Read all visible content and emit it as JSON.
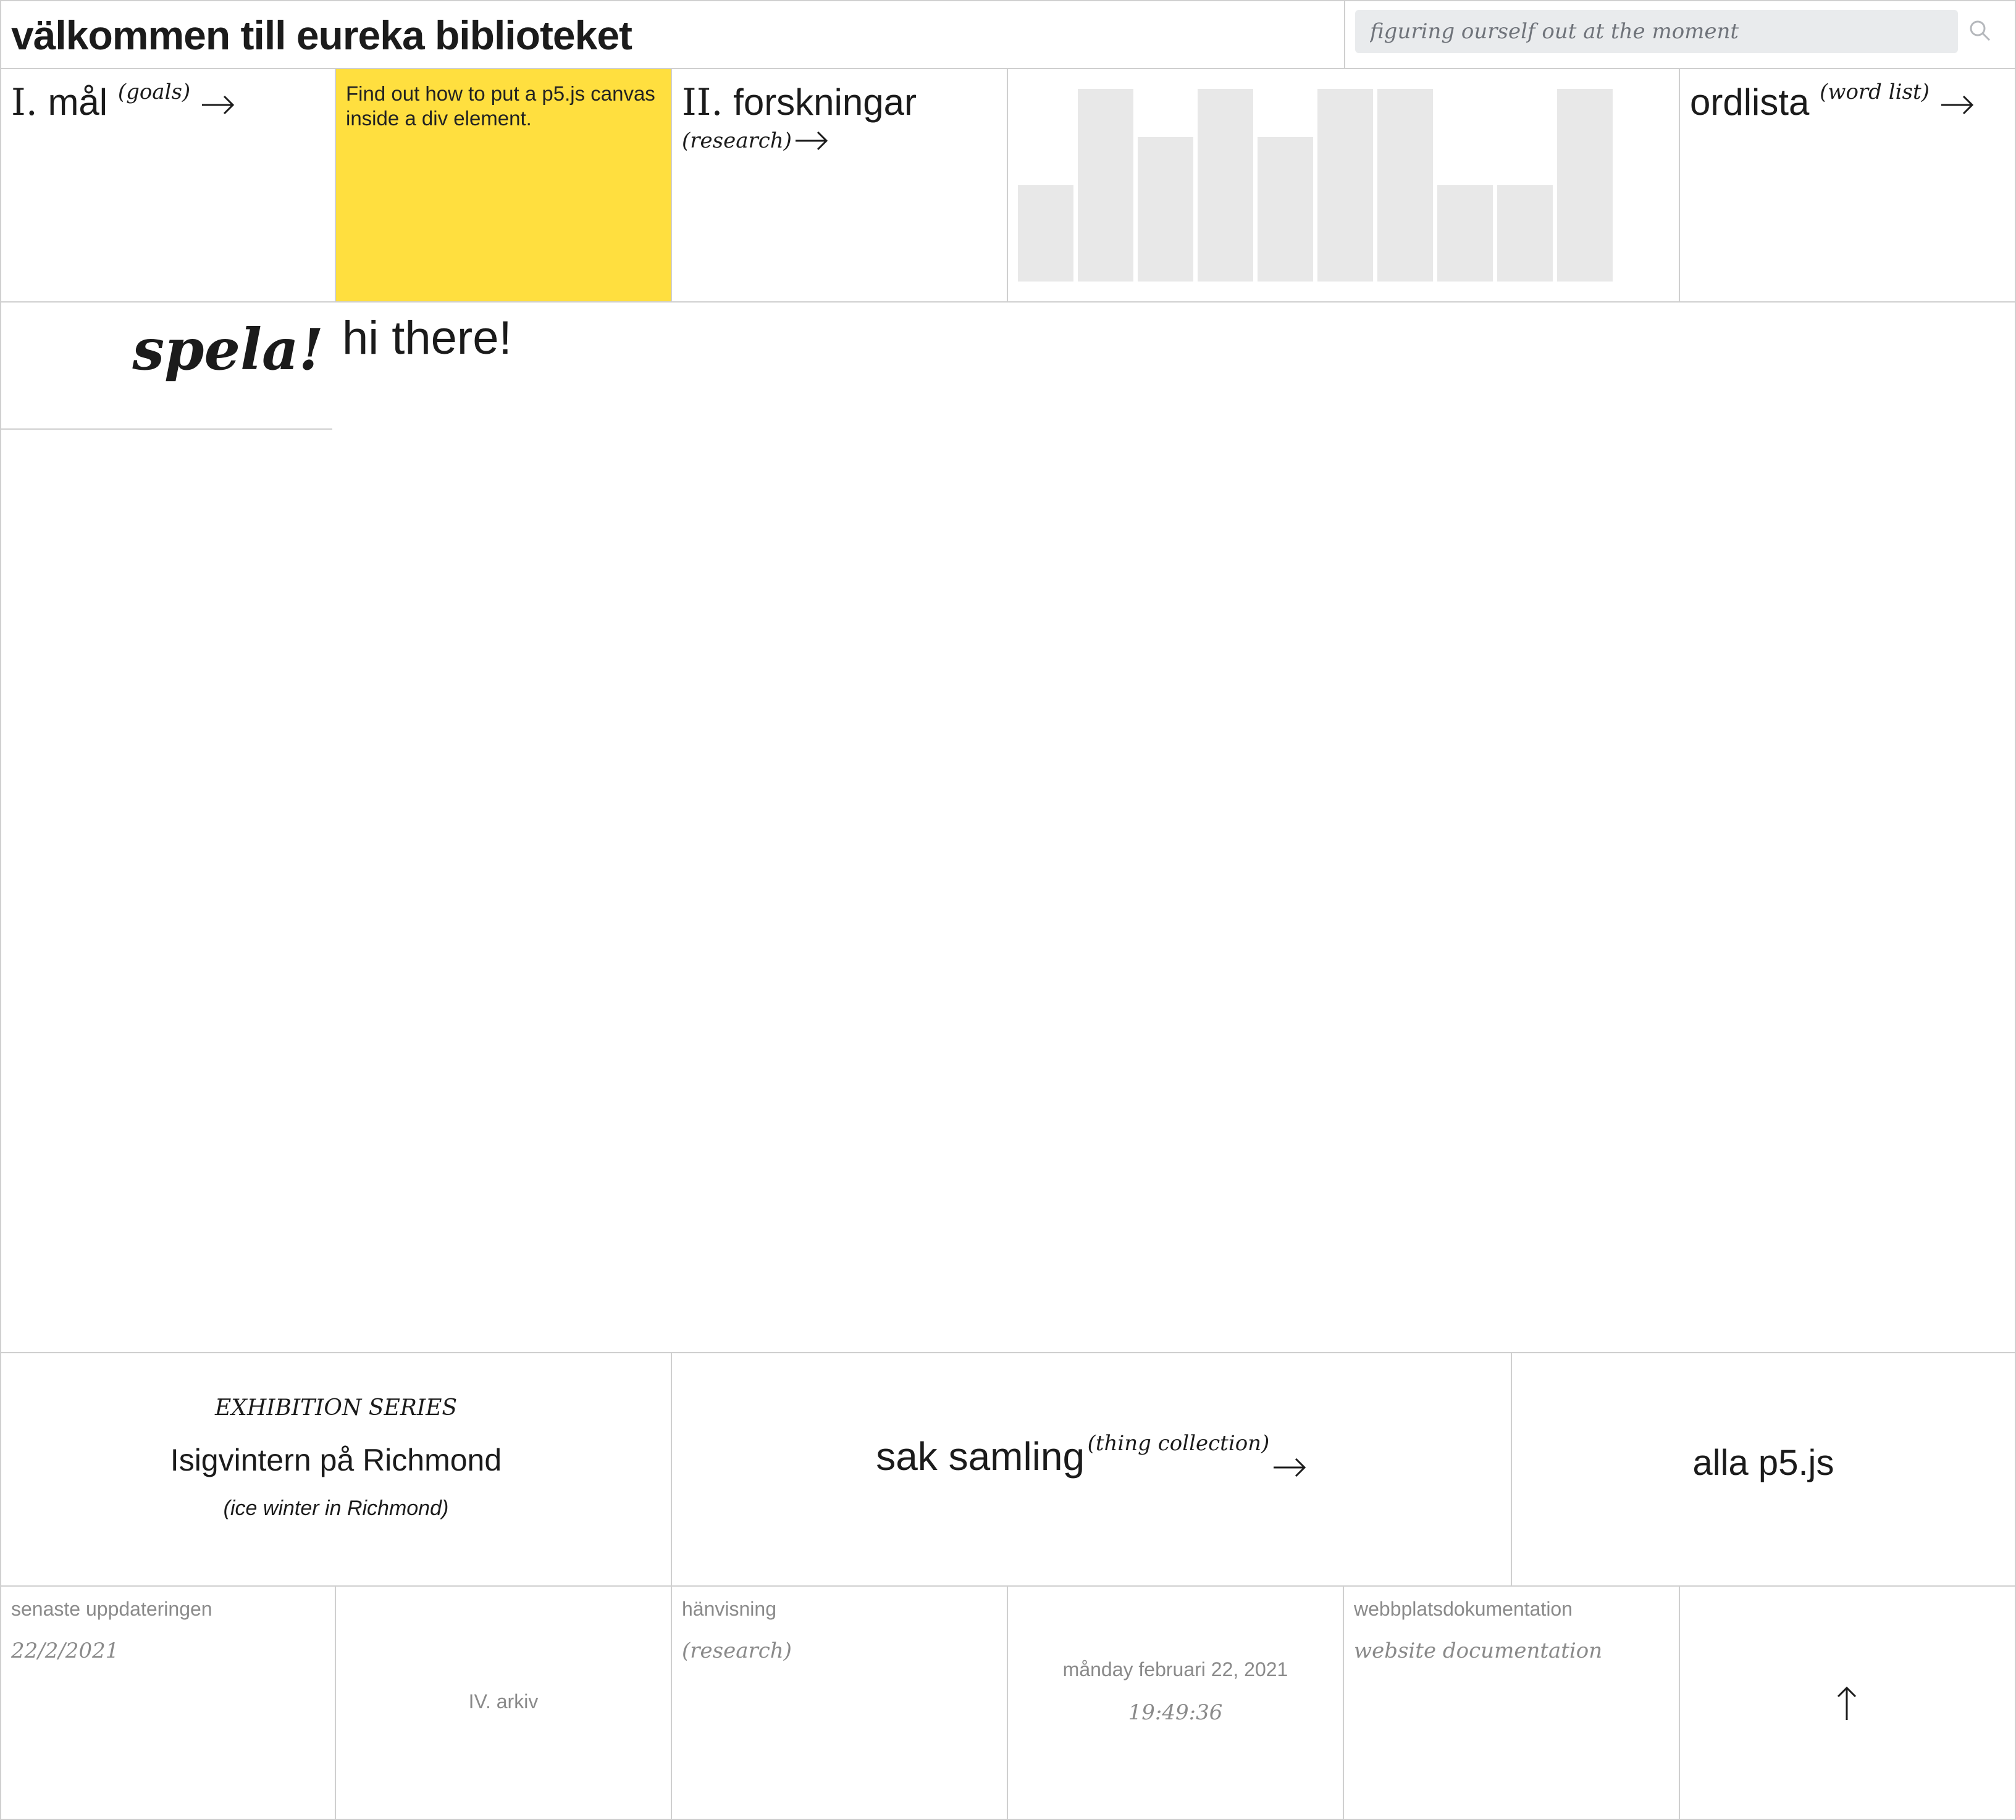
{
  "header": {
    "title": "välkommen till eureka biblioteket",
    "search_placeholder": "figuring ourself out at the moment",
    "search_icon": "search-icon"
  },
  "nav": {
    "goals": {
      "roman": "I.",
      "label": "mål",
      "sub": "(goals)"
    },
    "todo_note": "Find out how to put a p5.js canvas inside a div element.",
    "research": {
      "roman": "II.",
      "label": "forskningar",
      "sub": "(research)"
    },
    "wordlist": {
      "label": "ordlista",
      "sub": "(word list)"
    }
  },
  "bars": {
    "max": 4,
    "values": [
      2,
      4,
      3,
      4,
      3,
      4,
      4,
      2,
      2,
      4
    ]
  },
  "play": {
    "title": "spela!",
    "greeting": "hi there!"
  },
  "exhibition": {
    "kicker": "EXHIBITION SERIES",
    "title": "Isigvintern på Richmond",
    "subtitle": "(ice winter in Richmond)"
  },
  "collection": {
    "label": "sak samling",
    "sub": "(thing collection)"
  },
  "all_p5": {
    "label": "alla p5.js"
  },
  "footer": {
    "last_update_label": "senaste uppdateringen",
    "last_update_date": "22/2/2021",
    "archive": "IV. arkiv",
    "reference_label": "hänvisning",
    "reference_sub": "(research)",
    "date": "månday februari 22, 2021",
    "time": "19:49:36",
    "docs_label": "webbplatsdokumentation",
    "docs_sub": "website documentation"
  },
  "colors": {
    "note_yellow": "#ffdf3f",
    "bar_gray": "#e8e8e8",
    "border_gray": "#cfcfcf",
    "search_bg": "#e9ebed"
  }
}
